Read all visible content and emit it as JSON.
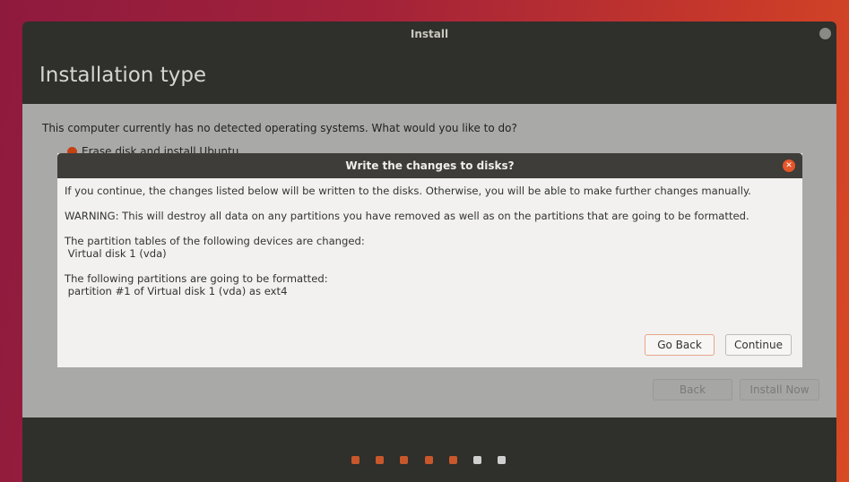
{
  "window": {
    "title": "Install",
    "page_title": "Installation type"
  },
  "content": {
    "question": "This computer currently has no detected operating systems. What would you like to do?",
    "option_erase": "Erase disk and install Ubuntu",
    "back": "Back",
    "install_now": "Install Now"
  },
  "dialog": {
    "title": "Write the changes to disks?",
    "line1": "If you continue, the changes listed below will be written to the disks. Otherwise, you will be able to make further changes manually.",
    "warning": "WARNING: This will destroy all data on any partitions you have removed as well as on the partitions that are going to be formatted.",
    "tables_header": "The partition tables of the following devices are changed:",
    "tables_device": " Virtual disk 1 (vda)",
    "format_header": "The following partitions are going to be formatted:",
    "format_item": " partition #1 of Virtual disk 1 (vda) as ext4",
    "go_back": "Go Back",
    "continue": "Continue"
  },
  "progress": {
    "total_steps": 7,
    "completed_steps": 5,
    "active_color": "#c8572b",
    "inactive_color": "#cfcfcf"
  }
}
